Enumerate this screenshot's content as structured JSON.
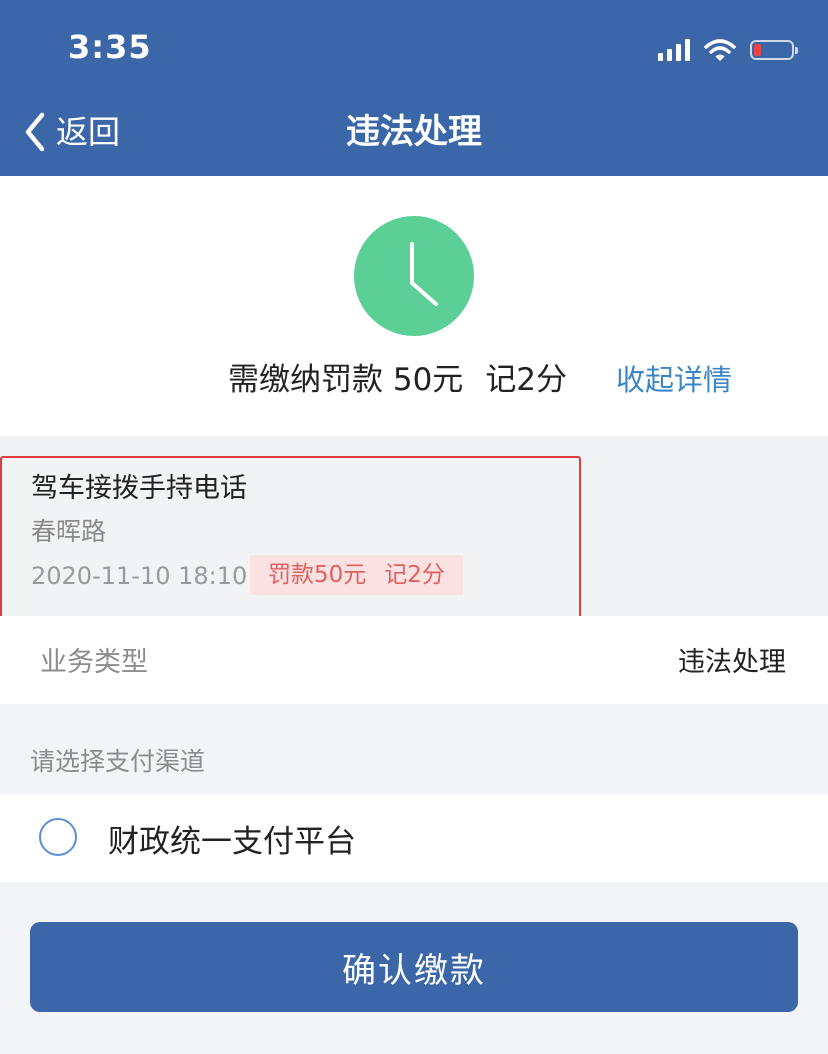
{
  "status_bar": {
    "time": "3:35",
    "icons": [
      "signal-icon",
      "wifi-icon",
      "battery-low-icon"
    ]
  },
  "nav": {
    "back_label": "返回",
    "title": "违法处理"
  },
  "summary": {
    "icon": "clock-icon",
    "fine_text": "需缴纳罚款 50元",
    "points_text": "记2分",
    "collapse_label": "收起详情"
  },
  "violation": {
    "title": "驾车接拨手持电话",
    "location": "春晖路",
    "datetime": "2020-11-10 18:10",
    "fine": "罚款50元",
    "points": "记2分"
  },
  "business": {
    "label": "业务类型",
    "value": "违法处理"
  },
  "payment": {
    "section_title": "请选择支付渠道",
    "options": [
      {
        "label": "财政统一支付平台",
        "selected": false
      }
    ]
  },
  "confirm_button_label": "确认缴款",
  "colors": {
    "primary": "#3b67a8",
    "clock_green": "#5ccf96",
    "link_blue": "#3a86c8",
    "highlight_red": "#e23c3c",
    "badge_bg": "#fbe2e2",
    "badge_text": "#e06060"
  }
}
